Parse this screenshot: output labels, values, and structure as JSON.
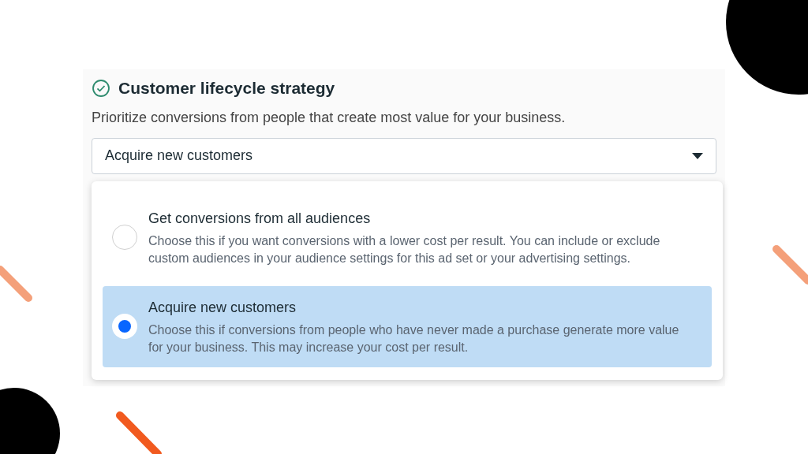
{
  "section": {
    "title": "Customer lifecycle strategy",
    "completed": true,
    "description": "Prioritize conversions from people that create most value for your business."
  },
  "select": {
    "value": "Acquire new customers",
    "expanded": true
  },
  "options": [
    {
      "title": "Get conversions from all audiences",
      "description": "Choose this if you want conversions with a lower cost per result. You can include or exclude custom audiences in your audience settings for this ad set or your advertising settings.",
      "selected": false
    },
    {
      "title": "Acquire new customers",
      "description": "Choose this if conversions from people who have never made a purchase generate more value for your business. This may increase your cost per result.",
      "selected": true
    }
  ]
}
